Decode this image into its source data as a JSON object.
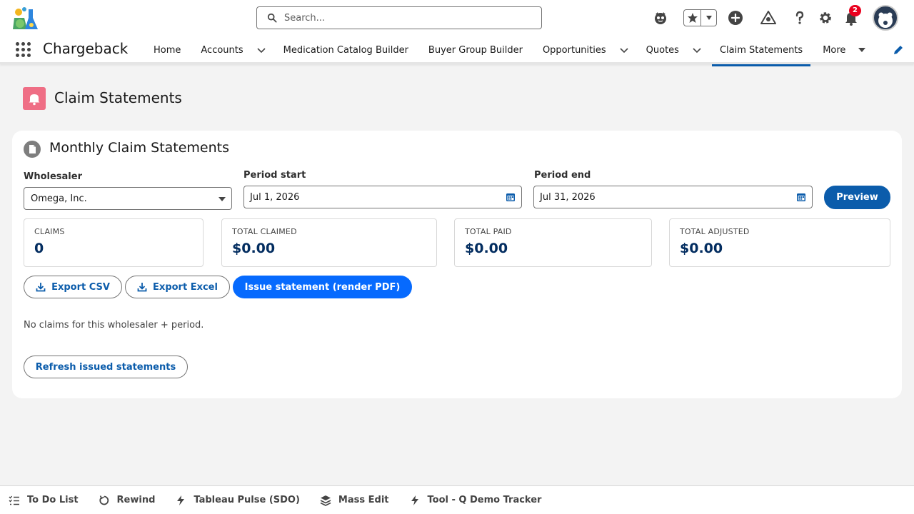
{
  "header": {
    "search_placeholder": "Search...",
    "notification_count": "2"
  },
  "nav": {
    "app_name": "Chargeback",
    "items": [
      {
        "label": "Home"
      },
      {
        "label": "Accounts"
      },
      {
        "label": "Medication Catalog Builder"
      },
      {
        "label": "Buyer Group Builder"
      },
      {
        "label": "Opportunities"
      },
      {
        "label": "Quotes"
      },
      {
        "label": "Claim Statements"
      },
      {
        "label": "More"
      }
    ],
    "active": "Claim Statements"
  },
  "page": {
    "title": "Claim Statements"
  },
  "card": {
    "title": "Monthly Claim Statements",
    "wholesaler_label": "Wholesaler",
    "wholesaler_value": "Omega, Inc.",
    "period_start_label": "Period start",
    "period_start_value": "Jul 1, 2026",
    "period_end_label": "Period end",
    "period_end_value": "Jul 31, 2026",
    "preview_label": "Preview",
    "stats": [
      {
        "label": "CLAIMS",
        "value": "0"
      },
      {
        "label": "TOTAL CLAIMED",
        "value": "$0.00"
      },
      {
        "label": "TOTAL PAID",
        "value": "$0.00"
      },
      {
        "label": "TOTAL ADJUSTED",
        "value": "$0.00"
      }
    ],
    "export_csv_label": "Export CSV",
    "export_excel_label": "Export Excel",
    "issue_label": "Issue statement (render PDF)",
    "empty_message": "No claims for this wholesaler + period.",
    "refresh_label": "Refresh issued statements"
  },
  "utility_bar": {
    "items": [
      {
        "label": "To Do List",
        "icon": "checklist-icon"
      },
      {
        "label": "Rewind",
        "icon": "rewind-icon"
      },
      {
        "label": "Tableau Pulse (SDO)",
        "icon": "lightning-icon"
      },
      {
        "label": "Mass Edit",
        "icon": "layers-icon"
      },
      {
        "label": "Tool - Q Demo Tracker",
        "icon": "lightning-icon"
      }
    ]
  },
  "colors": {
    "brand": "#0b5cab",
    "brand_button": "#066afe",
    "page_icon": "#ef6e85",
    "stat_value": "#032d60",
    "badge": "#ea001e"
  }
}
